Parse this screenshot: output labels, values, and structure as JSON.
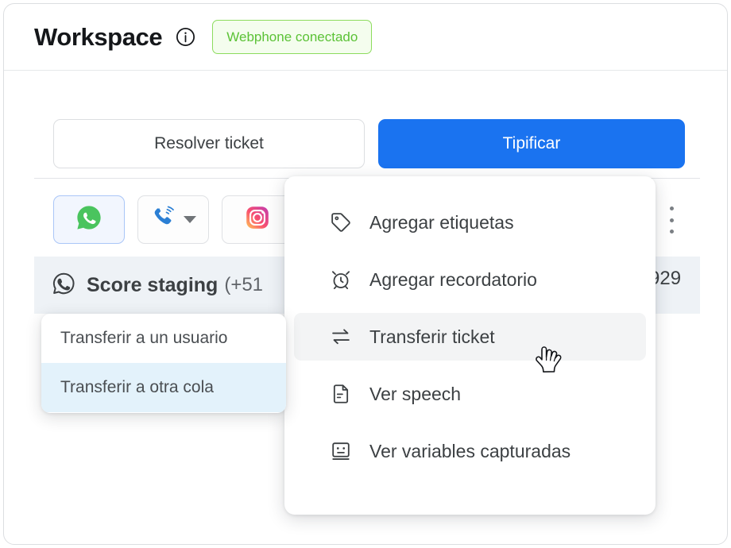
{
  "header": {
    "title": "Workspace",
    "info_icon": "info-circle-icon",
    "badge": {
      "label": "Webphone conectado",
      "text_color": "#5bc236",
      "border_color": "#8ddc5e",
      "background_color": "#f4fdee"
    }
  },
  "actions": {
    "resolve_label": "Resolver ticket",
    "classify_label": "Tipificar",
    "primary_color": "#1a73f0"
  },
  "channels": [
    {
      "name": "whatsapp",
      "icon": "whatsapp-icon",
      "active": true,
      "has_caret": false
    },
    {
      "name": "call",
      "icon": "phone-ringing-icon",
      "active": false,
      "has_caret": true
    },
    {
      "name": "instagram",
      "icon": "instagram-icon",
      "active": false,
      "has_caret": false
    }
  ],
  "overflow_menu_icon": "kebab-vertical-icon",
  "contact": {
    "channel_icon": "whatsapp-outline-icon",
    "name": "Score staging",
    "phone": "(+51",
    "phone_tail": "929",
    "row_background": "#eef2f6"
  },
  "dropdown": {
    "items": [
      {
        "icon": "tag-icon",
        "label": "Agregar etiquetas",
        "hovered": false
      },
      {
        "icon": "alarm-clock-icon",
        "label": "Agregar recordatorio",
        "hovered": false
      },
      {
        "icon": "transfer-arrows-icon",
        "label": "Transferir ticket",
        "hovered": true
      },
      {
        "icon": "document-icon",
        "label": "Ver speech",
        "hovered": false
      },
      {
        "icon": "face-square-icon",
        "label": "Ver variables capturadas",
        "hovered": false
      }
    ],
    "hover_background": "#f3f4f5"
  },
  "submenu": {
    "items": [
      {
        "label": "Transferir a un usuario",
        "highlight": false
      },
      {
        "label": "Transferir a otra cola",
        "highlight": true
      }
    ],
    "highlight_background": "#e3f2fb"
  },
  "cursor": {
    "type": "pointer-hand-cursor"
  }
}
